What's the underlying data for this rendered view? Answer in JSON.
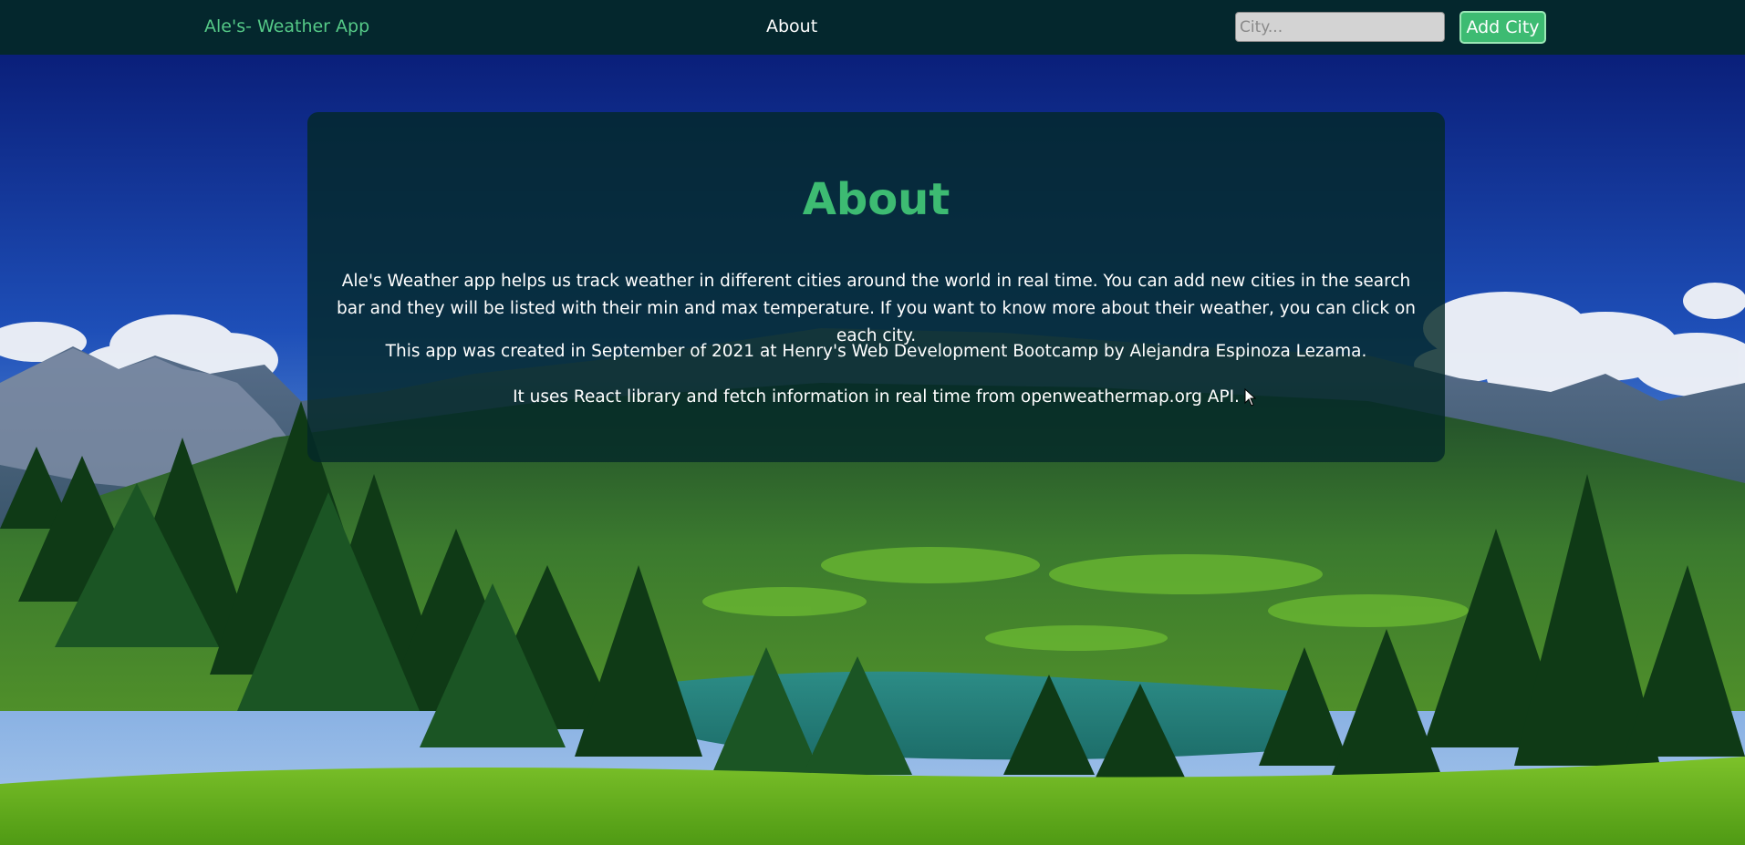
{
  "navbar": {
    "brand": "Ale's- Weather App",
    "about_link": "About",
    "search": {
      "placeholder": "City...",
      "value": ""
    },
    "add_button": "Add City"
  },
  "about_card": {
    "title": "About",
    "paragraph_1": "Ale's Weather app helps us track weather in different cities around the world in real time. You can add new cities in the search bar and they will be listed with their min and max temperature. If you want to know more about their weather, you can click on each city.",
    "paragraph_2": "This app was created in September of 2021 at Henry's Web Development Bootcamp by Alejandra Espinoza Lezama.",
    "paragraph_3": "It uses React library and fetch information in real time from openweathermap.org API."
  },
  "colors": {
    "navbar_bg": "#04272d",
    "brand": "#55c987",
    "accent_green": "#3dbb72",
    "card_bg": "rgba(4,40,40,0.82)"
  },
  "icons": [
    "mouse-pointer-icon"
  ]
}
